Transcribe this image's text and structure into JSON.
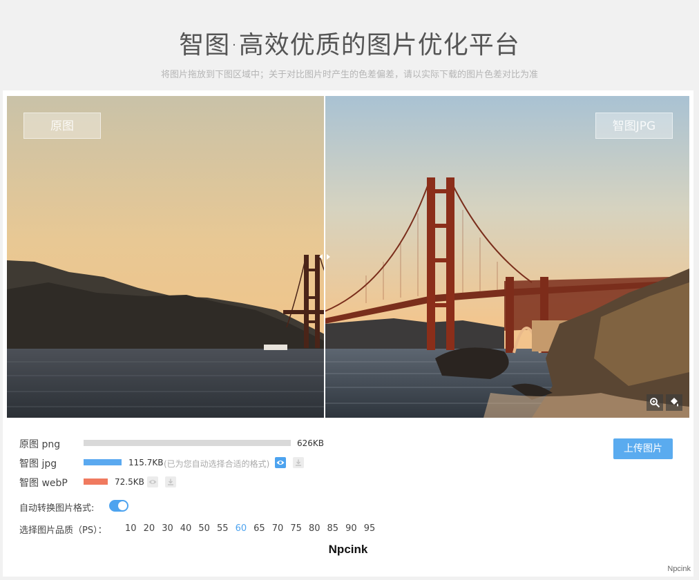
{
  "header": {
    "title": "智图·高效优质的图片优化平台",
    "subtitle": "将图片拖放到下图区域中；关于对比图片时产生的色差偏差，请以实际下载的图片色差对比为准"
  },
  "viewer": {
    "left_label": "原图",
    "right_label": "智图JPG",
    "tools": [
      "zoom-in-icon",
      "paint-bucket-icon"
    ]
  },
  "files": [
    {
      "label": "原图 png",
      "size": "626KB",
      "bar_fraction": 1.0,
      "color": "#d9d9d9"
    },
    {
      "label": "智图 jpg",
      "size": "115.7KB",
      "note": "(已为您自动选择合适的格式)",
      "bar_fraction": 0.185,
      "color": "#5aa9f0"
    },
    {
      "label": "智图 webP",
      "size": "72.5KB",
      "bar_fraction": 0.116,
      "color": "#f07a5f"
    }
  ],
  "upload_label": "上传图片",
  "auto_convert": {
    "label": "自动转换图片格式:",
    "enabled": true
  },
  "quality": {
    "label": "选择图片品质（PS）：",
    "options": [
      "10",
      "20",
      "30",
      "40",
      "50",
      "55",
      "60",
      "65",
      "70",
      "75",
      "80",
      "85",
      "90",
      "95"
    ],
    "selected": "60"
  },
  "brand": "Npcink",
  "watermark": "Npcink",
  "colors": {
    "accent": "#4da3ef",
    "button": "#5aabef",
    "webp": "#f07a5f",
    "jpg": "#5aa9f0"
  }
}
